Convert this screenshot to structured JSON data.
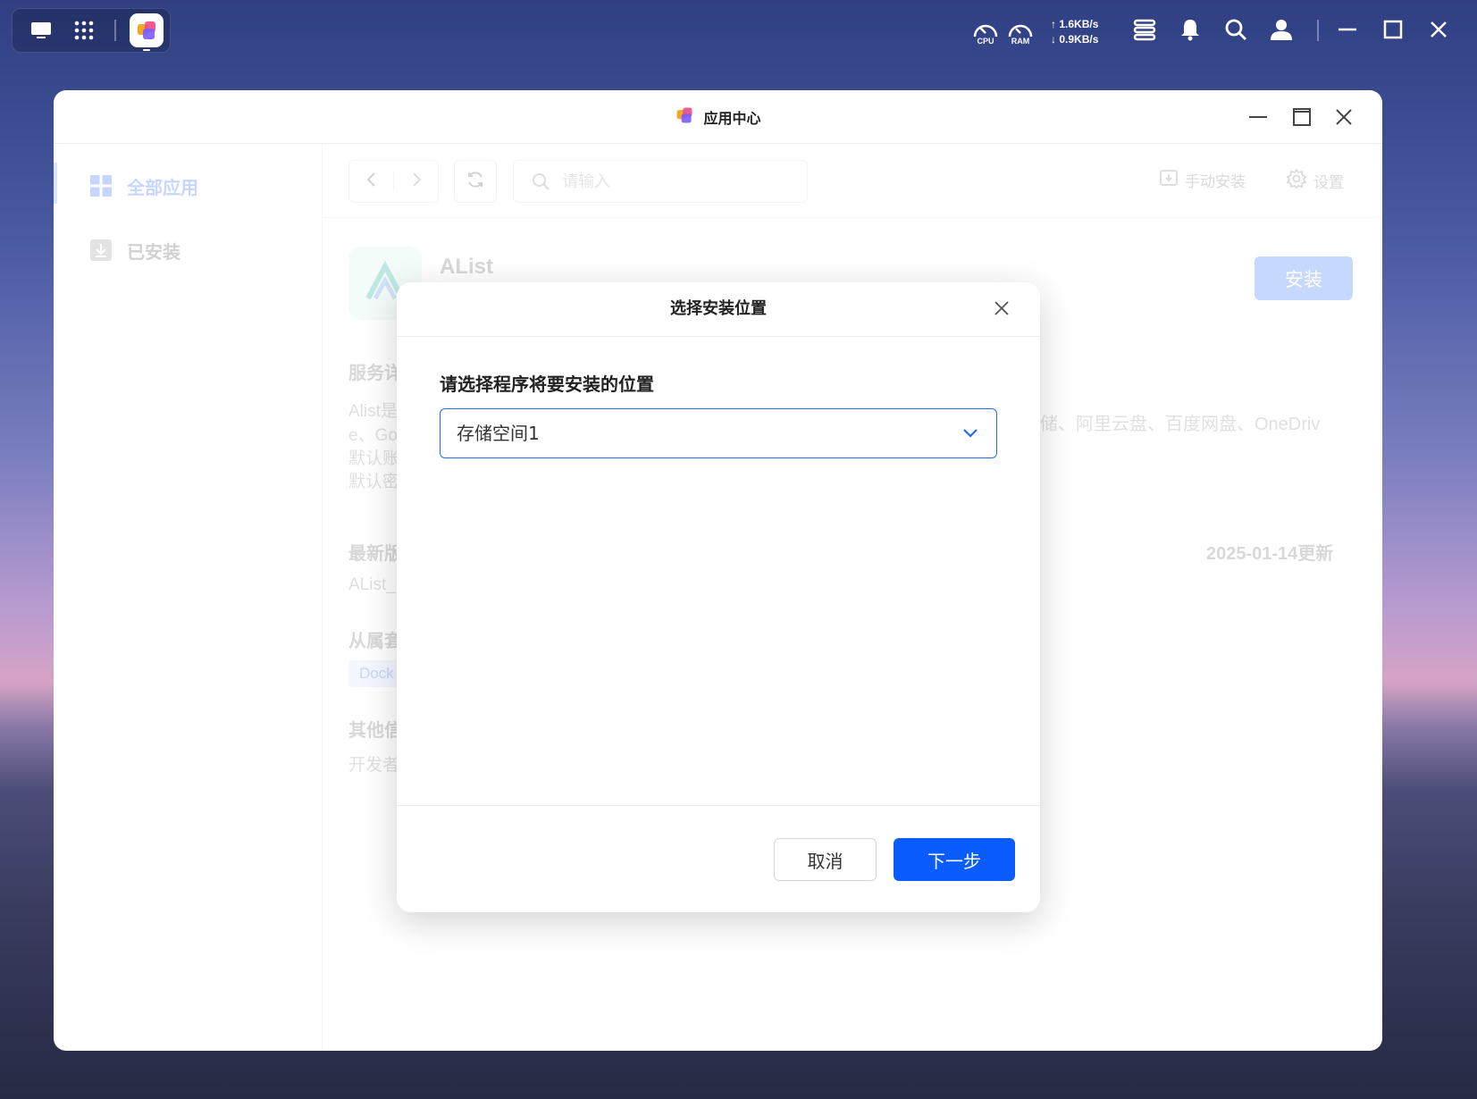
{
  "taskbar": {
    "cpu_label": "CPU",
    "ram_label": "RAM",
    "net_up": "1.6KB/s",
    "net_down": "0.9KB/s",
    "icons": [
      "desktop-icon",
      "app-grid-icon",
      "app-center-icon",
      "task-manager-icon",
      "bell-icon",
      "search-icon",
      "user-icon",
      "minimize-icon",
      "maximize-icon",
      "close-icon"
    ]
  },
  "window": {
    "title": "应用中心"
  },
  "sidebar": {
    "items": [
      {
        "label": "全部应用",
        "icon": "grid-icon",
        "active": true
      },
      {
        "label": "已安装",
        "icon": "download-icon",
        "active": false
      }
    ]
  },
  "toolbar": {
    "search_placeholder": "请输入",
    "manual_install": "手动安装",
    "settings": "设置"
  },
  "app_detail": {
    "name": "AList",
    "install_button": "安装",
    "service_heading": "服务详",
    "desc_lines": [
      "Alist是",
      "e、Go",
      "默认账",
      "默认密"
    ],
    "desc_right": "储、阿里云盘、百度网盘、OneDriv",
    "latest_heading": "最新版",
    "version_text": "AList_",
    "update_date": "2025-01-14更新",
    "category_heading": "从属套",
    "category_tag": "Dock",
    "other_heading": "其他信",
    "developer_text": "开发者"
  },
  "dialog": {
    "title": "选择安装位置",
    "prompt": "请选择程序将要安装的位置",
    "selected_location": "存储空间1",
    "cancel_label": "取消",
    "next_label": "下一步"
  },
  "colors": {
    "primary": "#0a5cff",
    "select_border": "#1f6bff",
    "sidebar_active": "#a9c1ff"
  }
}
